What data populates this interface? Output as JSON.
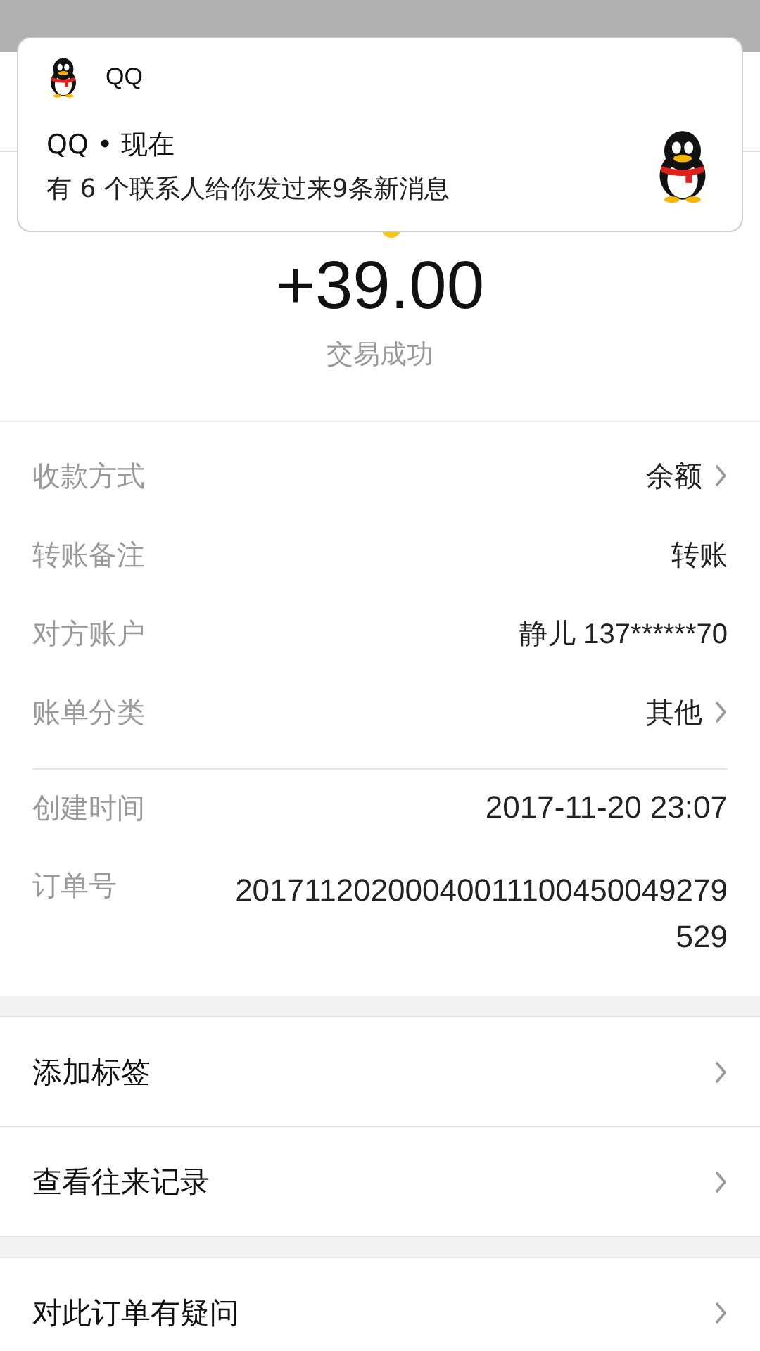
{
  "notification": {
    "app_name": "QQ",
    "title": "QQ • 现在",
    "message": "有 6 个联系人给你发过来9条新消息"
  },
  "amount": "+39.00",
  "status": "交易成功",
  "details": [
    {
      "label": "收款方式",
      "value": "余额",
      "link": true
    },
    {
      "label": "转账备注",
      "value": "转账",
      "link": false
    },
    {
      "label": "对方账户",
      "value": "静儿 137******70",
      "link": false
    },
    {
      "label": "账单分类",
      "value": "其他",
      "link": true
    }
  ],
  "meta": [
    {
      "label": "创建时间",
      "value": "2017-11-20 23:07"
    },
    {
      "label": "订单号",
      "value": "20171120200040011100450049279529"
    }
  ],
  "actions": [
    [
      "添加标签",
      "查看往来记录"
    ],
    [
      "对此订单有疑问"
    ]
  ]
}
